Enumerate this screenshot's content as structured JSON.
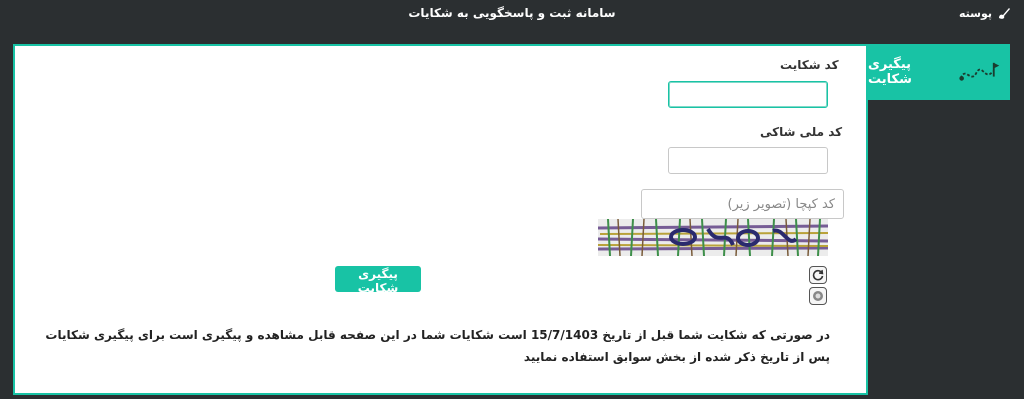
{
  "header": {
    "title": "سامانه ثبت و پاسخگویی به شکایات",
    "brand": "پوسته",
    "brand_icon": "brush-icon"
  },
  "sidebar": {
    "active_tab": "پیگیری شکایت",
    "tab_icon": "route-flag-icon",
    "accent_color": "#18c3a5"
  },
  "form": {
    "complaint_code_label": "کد شکایت",
    "complaint_code_value": "",
    "national_id_label": "کد ملی شاکی",
    "national_id_value": "",
    "captcha_placeholder": "کد کپچا (تصویر زیر)",
    "captcha_value": "",
    "refresh_icon": "refresh-icon",
    "audio_icon": "audio-icon",
    "submit_label": "پیگیری شکایت"
  },
  "note": {
    "text": "در صورتی که شکایت شما قبل از تاریخ 15/7/1403 است شکایات شما در این صفحه قابل مشاهده و پیگیری است برای پیگیری شکایات پس از تاریخ ذکر شده از بخش سوابق استفاده نمایید"
  }
}
